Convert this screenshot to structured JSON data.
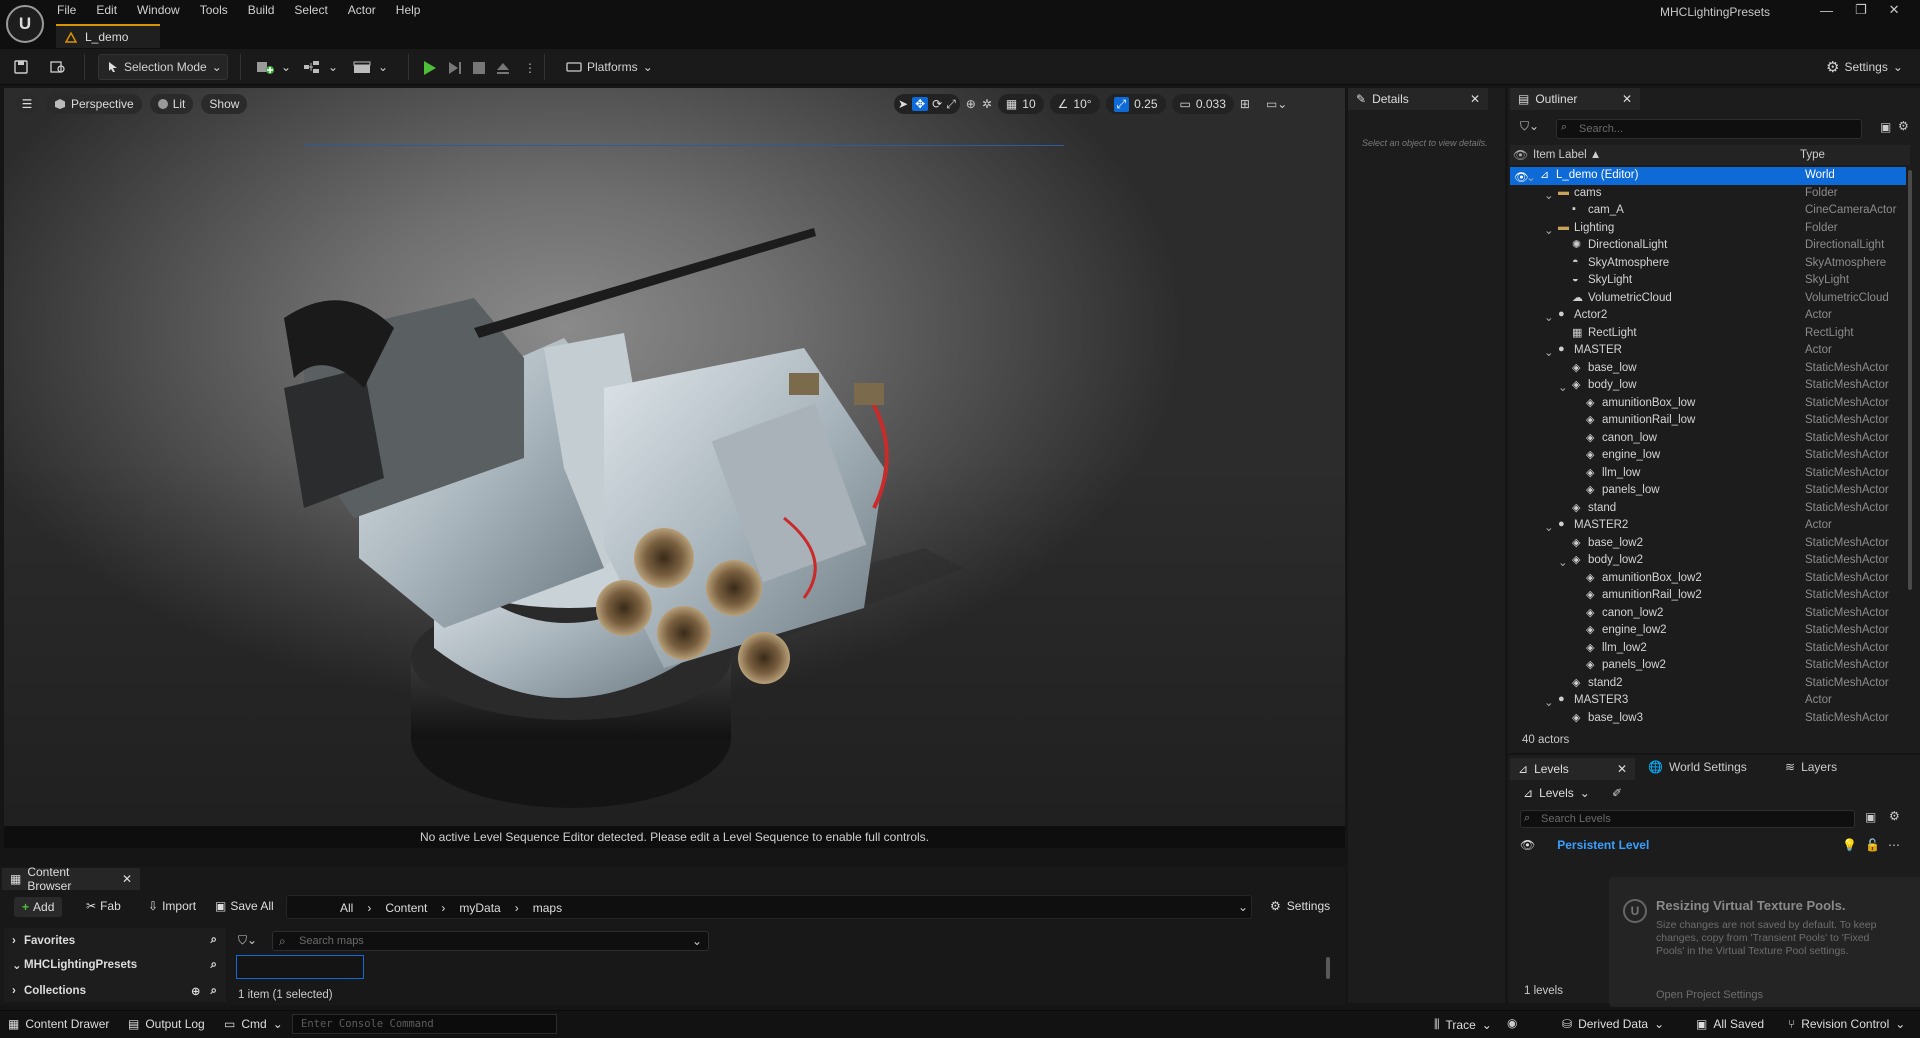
{
  "menu": [
    "File",
    "Edit",
    "Window",
    "Tools",
    "Build",
    "Select",
    "Actor",
    "Help"
  ],
  "document_tab": "L_demo",
  "project_name": "MHCLightingPresets",
  "toolbar": {
    "selection_mode": "Selection Mode",
    "platforms": "Platforms",
    "settings": "Settings"
  },
  "viewport": {
    "perspective": "Perspective",
    "lit": "Lit",
    "show": "Show",
    "grid_snap": "10",
    "rot_snap": "10°",
    "scale_snap": "0.25",
    "cam_speed": "0.033",
    "status_message": "No active Level Sequence Editor detected. Please edit a Level Sequence to enable full controls."
  },
  "details": {
    "tab": "Details",
    "empty_text": "Select an object to view details."
  },
  "outliner": {
    "tab": "Outliner",
    "search_placeholder": "Search...",
    "col_label": "Item Label ▲",
    "col_type": "Type",
    "count": "40 actors",
    "rows": [
      {
        "label": "L_demo (Editor)",
        "type": "World",
        "icon": "world-icon"
      },
      {
        "label": "cams",
        "type": "Folder",
        "icon": "folder-icon"
      },
      {
        "label": "cam_A",
        "type": "CineCameraActor",
        "icon": "camera-icon"
      },
      {
        "label": "Lighting",
        "type": "Folder",
        "icon": "folder-icon"
      },
      {
        "label": "DirectionalLight",
        "type": "DirectionalLight",
        "icon": "sun-icon"
      },
      {
        "label": "SkyAtmosphere",
        "type": "SkyAtmosphere",
        "icon": "atmosphere-icon"
      },
      {
        "label": "SkyLight",
        "type": "SkyLight",
        "icon": "skylight-icon"
      },
      {
        "label": "VolumetricCloud",
        "type": "VolumetricCloud",
        "icon": "cloud-icon"
      },
      {
        "label": "Actor2",
        "type": "Actor",
        "icon": "actor-icon"
      },
      {
        "label": "RectLight",
        "type": "RectLight",
        "icon": "rectlight-icon"
      },
      {
        "label": "MASTER",
        "type": "Actor",
        "icon": "actor-icon"
      },
      {
        "label": "base_low",
        "type": "StaticMeshActor",
        "icon": "mesh-icon"
      },
      {
        "label": "body_low",
        "type": "StaticMeshActor",
        "icon": "mesh-icon"
      },
      {
        "label": "amunitionBox_low",
        "type": "StaticMeshActor",
        "icon": "mesh-icon"
      },
      {
        "label": "amunitionRail_low",
        "type": "StaticMeshActor",
        "icon": "mesh-icon"
      },
      {
        "label": "canon_low",
        "type": "StaticMeshActor",
        "icon": "mesh-icon"
      },
      {
        "label": "engine_low",
        "type": "StaticMeshActor",
        "icon": "mesh-icon"
      },
      {
        "label": "llm_low",
        "type": "StaticMeshActor",
        "icon": "mesh-icon"
      },
      {
        "label": "panels_low",
        "type": "StaticMeshActor",
        "icon": "mesh-icon"
      },
      {
        "label": "stand",
        "type": "StaticMeshActor",
        "icon": "mesh-icon"
      },
      {
        "label": "MASTER2",
        "type": "Actor",
        "icon": "actor-icon"
      },
      {
        "label": "base_low2",
        "type": "StaticMeshActor",
        "icon": "mesh-icon"
      },
      {
        "label": "body_low2",
        "type": "StaticMeshActor",
        "icon": "mesh-icon"
      },
      {
        "label": "amunitionBox_low2",
        "type": "StaticMeshActor",
        "icon": "mesh-icon"
      },
      {
        "label": "amunitionRail_low2",
        "type": "StaticMeshActor",
        "icon": "mesh-icon"
      },
      {
        "label": "canon_low2",
        "type": "StaticMeshActor",
        "icon": "mesh-icon"
      },
      {
        "label": "engine_low2",
        "type": "StaticMeshActor",
        "icon": "mesh-icon"
      },
      {
        "label": "llm_low2",
        "type": "StaticMeshActor",
        "icon": "mesh-icon"
      },
      {
        "label": "panels_low2",
        "type": "StaticMeshActor",
        "icon": "mesh-icon"
      },
      {
        "label": "stand2",
        "type": "StaticMeshActor",
        "icon": "mesh-icon"
      },
      {
        "label": "MASTER3",
        "type": "Actor",
        "icon": "actor-icon"
      },
      {
        "label": "base_low3",
        "type": "StaticMeshActor",
        "icon": "mesh-icon"
      }
    ]
  },
  "levels": {
    "tab": "Levels",
    "tab2": "World Settings",
    "tab3": "Layers",
    "dropdown": "Levels",
    "search_placeholder": "Search Levels",
    "persistent": "Persistent Level",
    "count": "1 levels"
  },
  "toast": {
    "title": "Resizing Virtual Texture Pools.",
    "body": "Size changes are not saved by default. To keep changes, copy from 'Transient Pools' to 'Fixed Pools' in the Virtual Texture Pool settings.",
    "link": "Open Project Settings"
  },
  "content_browser": {
    "tab": "Content Browser",
    "add": "Add",
    "fab": "Fab",
    "import": "Import",
    "save_all": "Save All",
    "path": [
      "All",
      "Content",
      "myData",
      "maps"
    ],
    "settings": "Settings",
    "favorites": "Favorites",
    "project": "MHCLightingPresets",
    "collections": "Collections",
    "search_placeholder": "Search maps",
    "item_count": "1 item (1 selected)"
  },
  "statusbar": {
    "content_drawer": "Content Drawer",
    "output_log": "Output Log",
    "cmd": "Cmd",
    "console_placeholder": "Enter Console Command",
    "trace": "Trace",
    "derived_data": "Derived Data",
    "all_saved": "All Saved",
    "revision_control": "Revision Control"
  },
  "colors": {
    "accent_blue": "#0d6ad6",
    "play_green": "#4fbf3a",
    "tab_orange": "#d99400",
    "persistent_blue": "#3aa0ff"
  }
}
